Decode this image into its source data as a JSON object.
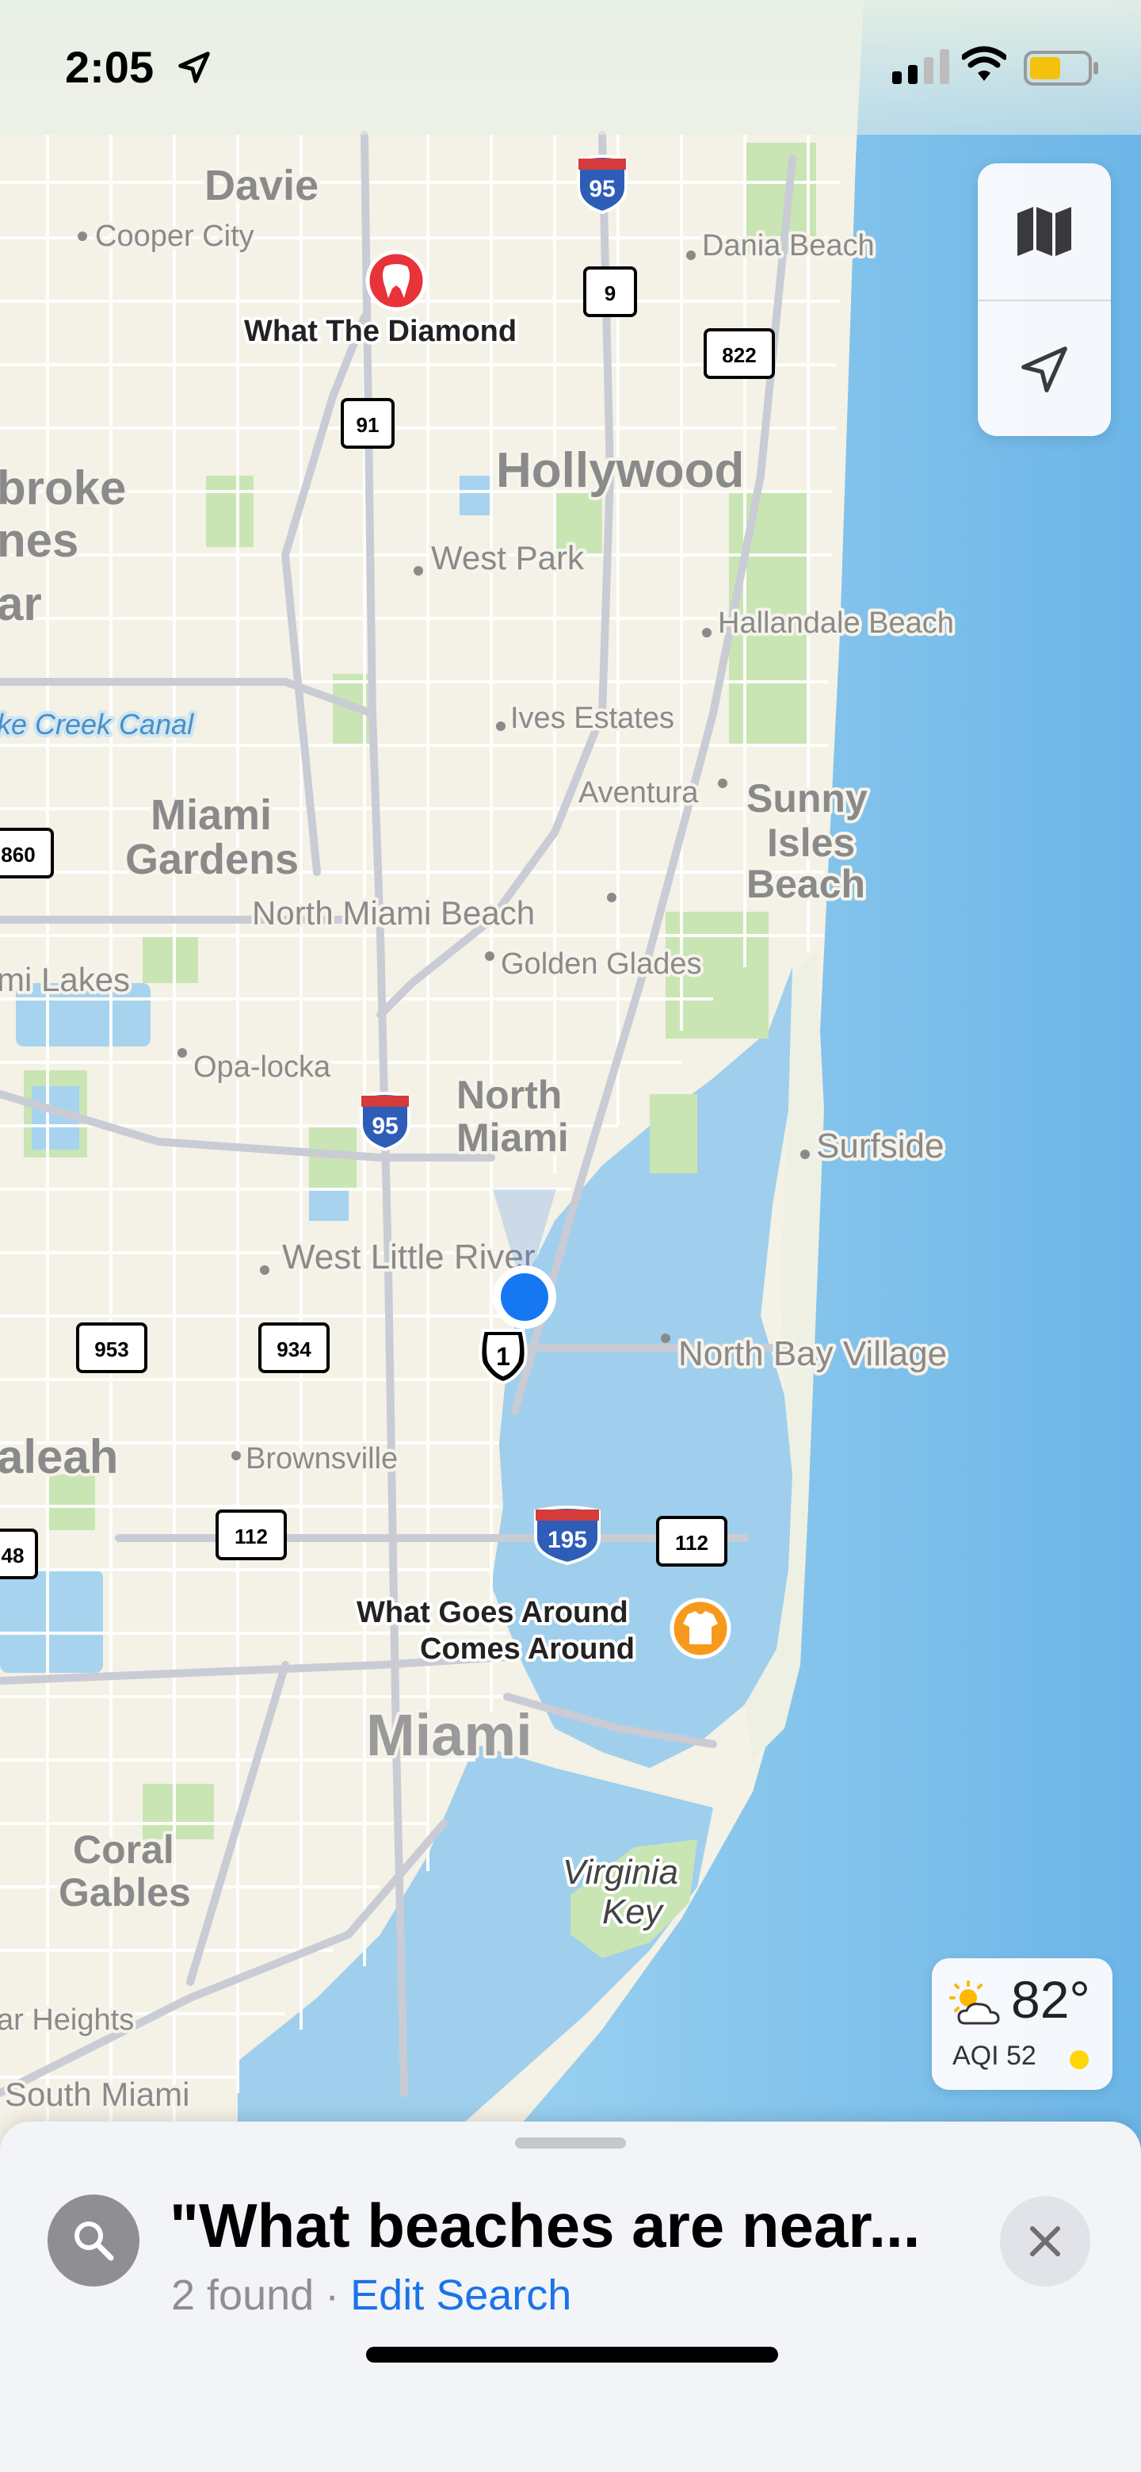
{
  "status_bar": {
    "time": "2:05",
    "icons": [
      "location-arrow-icon",
      "cellular-signal-icon",
      "wifi-icon",
      "battery-icon"
    ]
  },
  "map": {
    "cities": {
      "davie": "Davie",
      "cooper_city": "Cooper City",
      "dania_beach": "Dania Beach",
      "hollywood": "Hollywood",
      "pembroke_partial": "broke",
      "pines_partial": "nes",
      "ar_partial": "ar",
      "west_park": "West Park",
      "hallandale_beach": "Hallandale Beach",
      "ives_estates": "Ives Estates",
      "aventura": "Aventura",
      "sunny": "Sunny",
      "isles": "Isles",
      "beach": "Beach",
      "miami_word": "Miami",
      "gardens_word": "Gardens",
      "north_miami_beach": "North Miami Beach",
      "golden_glades": "Golden Glades",
      "mi_lakes": "mi Lakes",
      "opa_locka": "Opa-locka",
      "north_word": "North",
      "surfside": "Surfside",
      "west_little_river": "West Little River",
      "north_bay_village": "North Bay Village",
      "hialeah_partial": "aleah",
      "brownsville": "Brownsville",
      "miami": "Miami",
      "coral": "Coral",
      "gables": "Gables",
      "ar_heights": "ar Heights",
      "south_miami": "South Miami"
    },
    "water": {
      "creek_canal": "ke Creek Canal",
      "virginia": "Virginia",
      "key": "Key"
    },
    "shields": {
      "i95_top": "95",
      "i95_mid": "95",
      "i195": "195",
      "us1": "1",
      "sr9": "9",
      "sr822": "822",
      "sr91": "91",
      "sr860": "860",
      "sr953": "953",
      "sr934": "934",
      "sr112_left": "112",
      "sr112_right": "112",
      "sr48": "48"
    },
    "pois": [
      {
        "name": "What The Diamond",
        "category": "tooth-pin-icon",
        "color": "#e8333a"
      },
      {
        "name_line1": "What Goes Around",
        "name_line2": "Comes Around",
        "category": "shirt-pin-icon",
        "color": "#f79a1c"
      }
    ],
    "user_location_color": "#1677f2"
  },
  "controls": {
    "map_mode_icon": "map-icon",
    "tracking_icon": "location-arrow-icon"
  },
  "weather": {
    "temperature": "82°",
    "aqi": "AQI 52",
    "condition_icon": "partly-cloudy-icon"
  },
  "results_sheet": {
    "title": "\"What beaches are near...",
    "found": "2 found",
    "separator": "·",
    "edit_search": "Edit Search"
  },
  "colors": {
    "water": "#9fd0ee",
    "land": "#f4f1e6",
    "park": "#c9e5b4",
    "link": "#1a73e8"
  }
}
